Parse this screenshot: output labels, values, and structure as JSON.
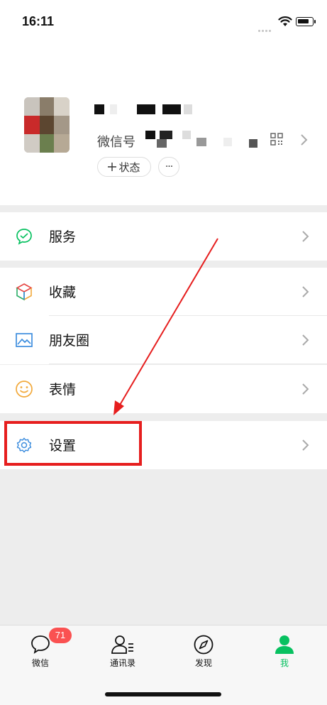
{
  "status_bar": {
    "time": "16:11"
  },
  "profile": {
    "wxid_label": "微信号",
    "status_button_label": "状态",
    "more_label": "···"
  },
  "menu": {
    "service": {
      "label": "服务"
    },
    "favorites": {
      "label": "收藏"
    },
    "moments": {
      "label": "朋友圈"
    },
    "stickers": {
      "label": "表情"
    },
    "settings": {
      "label": "设置"
    }
  },
  "tabbar": {
    "chats": {
      "label": "微信",
      "badge": "71"
    },
    "contacts": {
      "label": "通讯录"
    },
    "discover": {
      "label": "发现"
    },
    "me": {
      "label": "我"
    }
  },
  "colors": {
    "accent": "#07c160",
    "badge": "#fa5151",
    "highlight": "#e61e1e",
    "background": "#ededed"
  },
  "icons": [
    "wifi-icon",
    "battery-icon",
    "qr-code-icon",
    "chevron-right-icon",
    "plus-icon",
    "service-icon",
    "cube-icon",
    "image-icon",
    "smile-icon",
    "gear-icon",
    "chat-bubble-icon",
    "contacts-icon",
    "compass-icon",
    "person-icon"
  ]
}
